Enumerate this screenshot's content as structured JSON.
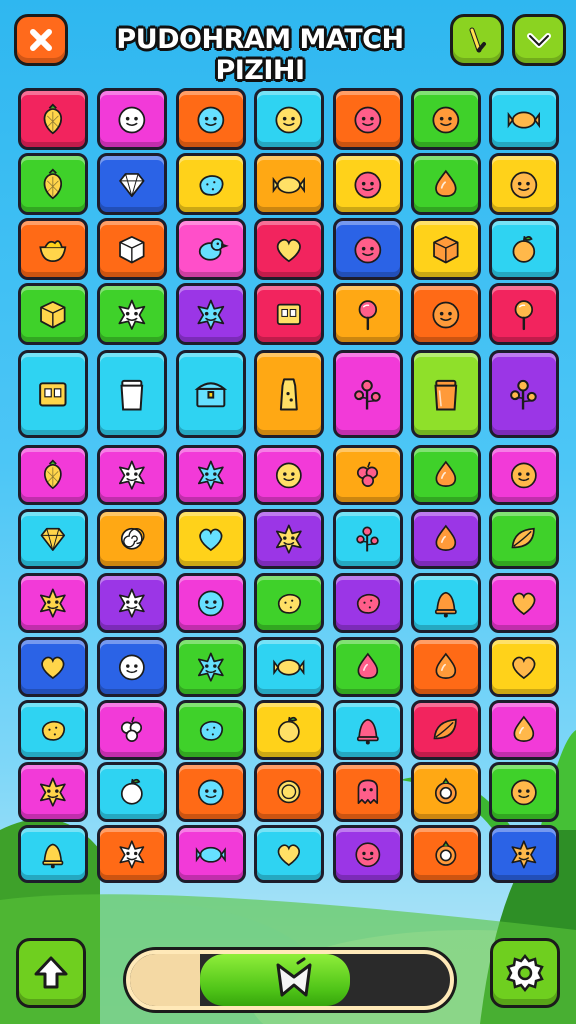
{
  "header": {
    "title": "PUDOHRAM MATCH  PIZIHI",
    "close_icon": "close-icon",
    "hint_icon": "hint-stick-icon",
    "confirm_icon": "chevron-down-icon"
  },
  "colors": {
    "red": "#f2245e",
    "pink": "#ff4fc9",
    "magenta": "#f23ad8",
    "orange": "#ff6a16",
    "yellow": "#ffd21a",
    "cyan": "#2fd3f2",
    "green": "#3fd12a",
    "blue": "#2b63e6",
    "purple": "#9b36e6",
    "lime": "#8fe02a",
    "amber": "#ffa814"
  },
  "board": {
    "rows": [
      [
        {
          "c": "red",
          "icon": "berry"
        },
        {
          "c": "magenta",
          "icon": "face"
        },
        {
          "c": "orange",
          "icon": "face"
        },
        {
          "c": "cyan",
          "icon": "face"
        },
        {
          "c": "orange",
          "icon": "face"
        },
        {
          "c": "green",
          "icon": "face"
        },
        {
          "c": "cyan",
          "icon": "candy"
        }
      ],
      [
        {
          "c": "green",
          "icon": "berry"
        },
        {
          "c": "blue",
          "icon": "gem"
        },
        {
          "c": "yellow",
          "icon": "potato"
        },
        {
          "c": "amber",
          "icon": "candy"
        },
        {
          "c": "yellow",
          "icon": "face"
        },
        {
          "c": "green",
          "icon": "drop"
        },
        {
          "c": "yellow",
          "icon": "face"
        }
      ],
      [
        {
          "c": "orange",
          "icon": "bowl"
        },
        {
          "c": "orange",
          "icon": "cube"
        },
        {
          "c": "pink",
          "icon": "bird"
        },
        {
          "c": "red",
          "icon": "heart"
        },
        {
          "c": "blue",
          "icon": "face"
        },
        {
          "c": "yellow",
          "icon": "cube"
        },
        {
          "c": "cyan",
          "icon": "apple"
        }
      ],
      [
        {
          "c": "green",
          "icon": "cube"
        },
        {
          "c": "green",
          "icon": "star"
        },
        {
          "c": "purple",
          "icon": "star"
        },
        {
          "c": "red",
          "icon": "box"
        },
        {
          "c": "amber",
          "icon": "lolly"
        },
        {
          "c": "orange",
          "icon": "face"
        },
        {
          "c": "red",
          "icon": "lolly"
        }
      ],
      [
        {
          "c": "cyan",
          "icon": "box"
        },
        {
          "c": "cyan",
          "icon": "jar"
        },
        {
          "c": "cyan",
          "icon": "chest"
        },
        {
          "c": "amber",
          "icon": "bottle"
        },
        {
          "c": "magenta",
          "icon": "flower"
        },
        {
          "c": "lime",
          "icon": "jar"
        },
        {
          "c": "purple",
          "icon": "flower"
        }
      ],
      [
        {
          "c": "magenta",
          "icon": "berry"
        },
        {
          "c": "magenta",
          "icon": "star"
        },
        {
          "c": "magenta",
          "icon": "star"
        },
        {
          "c": "magenta",
          "icon": "face"
        },
        {
          "c": "amber",
          "icon": "grape"
        },
        {
          "c": "green",
          "icon": "drop"
        },
        {
          "c": "magenta",
          "icon": "face"
        }
      ],
      [
        {
          "c": "cyan",
          "icon": "gem"
        },
        {
          "c": "amber",
          "icon": "swirl"
        },
        {
          "c": "yellow",
          "icon": "heart"
        },
        {
          "c": "purple",
          "icon": "star"
        },
        {
          "c": "cyan",
          "icon": "flower"
        },
        {
          "c": "purple",
          "icon": "drop"
        },
        {
          "c": "green",
          "icon": "leaf"
        }
      ],
      [
        {
          "c": "magenta",
          "icon": "star"
        },
        {
          "c": "purple",
          "icon": "star"
        },
        {
          "c": "magenta",
          "icon": "face"
        },
        {
          "c": "green",
          "icon": "potato"
        },
        {
          "c": "purple",
          "icon": "potato"
        },
        {
          "c": "cyan",
          "icon": "bell"
        },
        {
          "c": "magenta",
          "icon": "heart"
        }
      ],
      [
        {
          "c": "blue",
          "icon": "heart"
        },
        {
          "c": "blue",
          "icon": "face"
        },
        {
          "c": "green",
          "icon": "star"
        },
        {
          "c": "cyan",
          "icon": "candy"
        },
        {
          "c": "green",
          "icon": "drop"
        },
        {
          "c": "orange",
          "icon": "drop"
        },
        {
          "c": "yellow",
          "icon": "heart"
        }
      ],
      [
        {
          "c": "cyan",
          "icon": "potato"
        },
        {
          "c": "magenta",
          "icon": "grape"
        },
        {
          "c": "green",
          "icon": "potato"
        },
        {
          "c": "yellow",
          "icon": "apple"
        },
        {
          "c": "cyan",
          "icon": "bell"
        },
        {
          "c": "red",
          "icon": "leaf"
        },
        {
          "c": "magenta",
          "icon": "drop"
        }
      ],
      [
        {
          "c": "magenta",
          "icon": "star"
        },
        {
          "c": "cyan",
          "icon": "apple"
        },
        {
          "c": "orange",
          "icon": "face"
        },
        {
          "c": "orange",
          "icon": "coin"
        },
        {
          "c": "orange",
          "icon": "ghost"
        },
        {
          "c": "amber",
          "icon": "ring"
        },
        {
          "c": "green",
          "icon": "face"
        }
      ],
      [
        {
          "c": "cyan",
          "icon": "bell"
        },
        {
          "c": "orange",
          "icon": "star"
        },
        {
          "c": "magenta",
          "icon": "candy"
        },
        {
          "c": "cyan",
          "icon": "heart"
        },
        {
          "c": "purple",
          "icon": "face"
        },
        {
          "c": "orange",
          "icon": "ring"
        },
        {
          "c": "blue",
          "icon": "star"
        }
      ]
    ]
  },
  "footer": {
    "up_icon": "arrow-up-icon",
    "settings_icon": "gear-icon",
    "progress": 0.6,
    "progress_knob_icon": "bowtie-icon"
  }
}
